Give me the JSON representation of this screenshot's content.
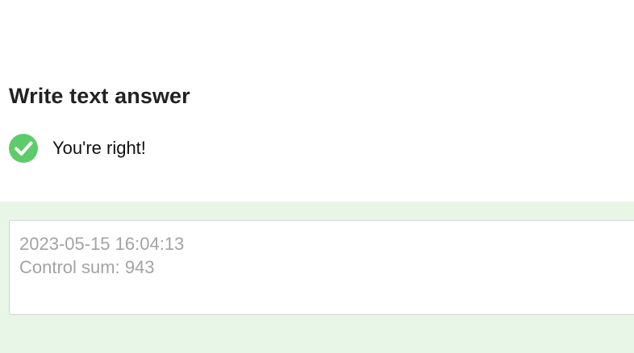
{
  "question": {
    "title": "Write text answer"
  },
  "result": {
    "icon": "check-circle-icon",
    "message": "You're right!",
    "color": "#5ecb6a"
  },
  "answer": {
    "line1": "2023-05-15 16:04:13",
    "line2": "Control sum: 943",
    "background": "#e8f6e8"
  }
}
